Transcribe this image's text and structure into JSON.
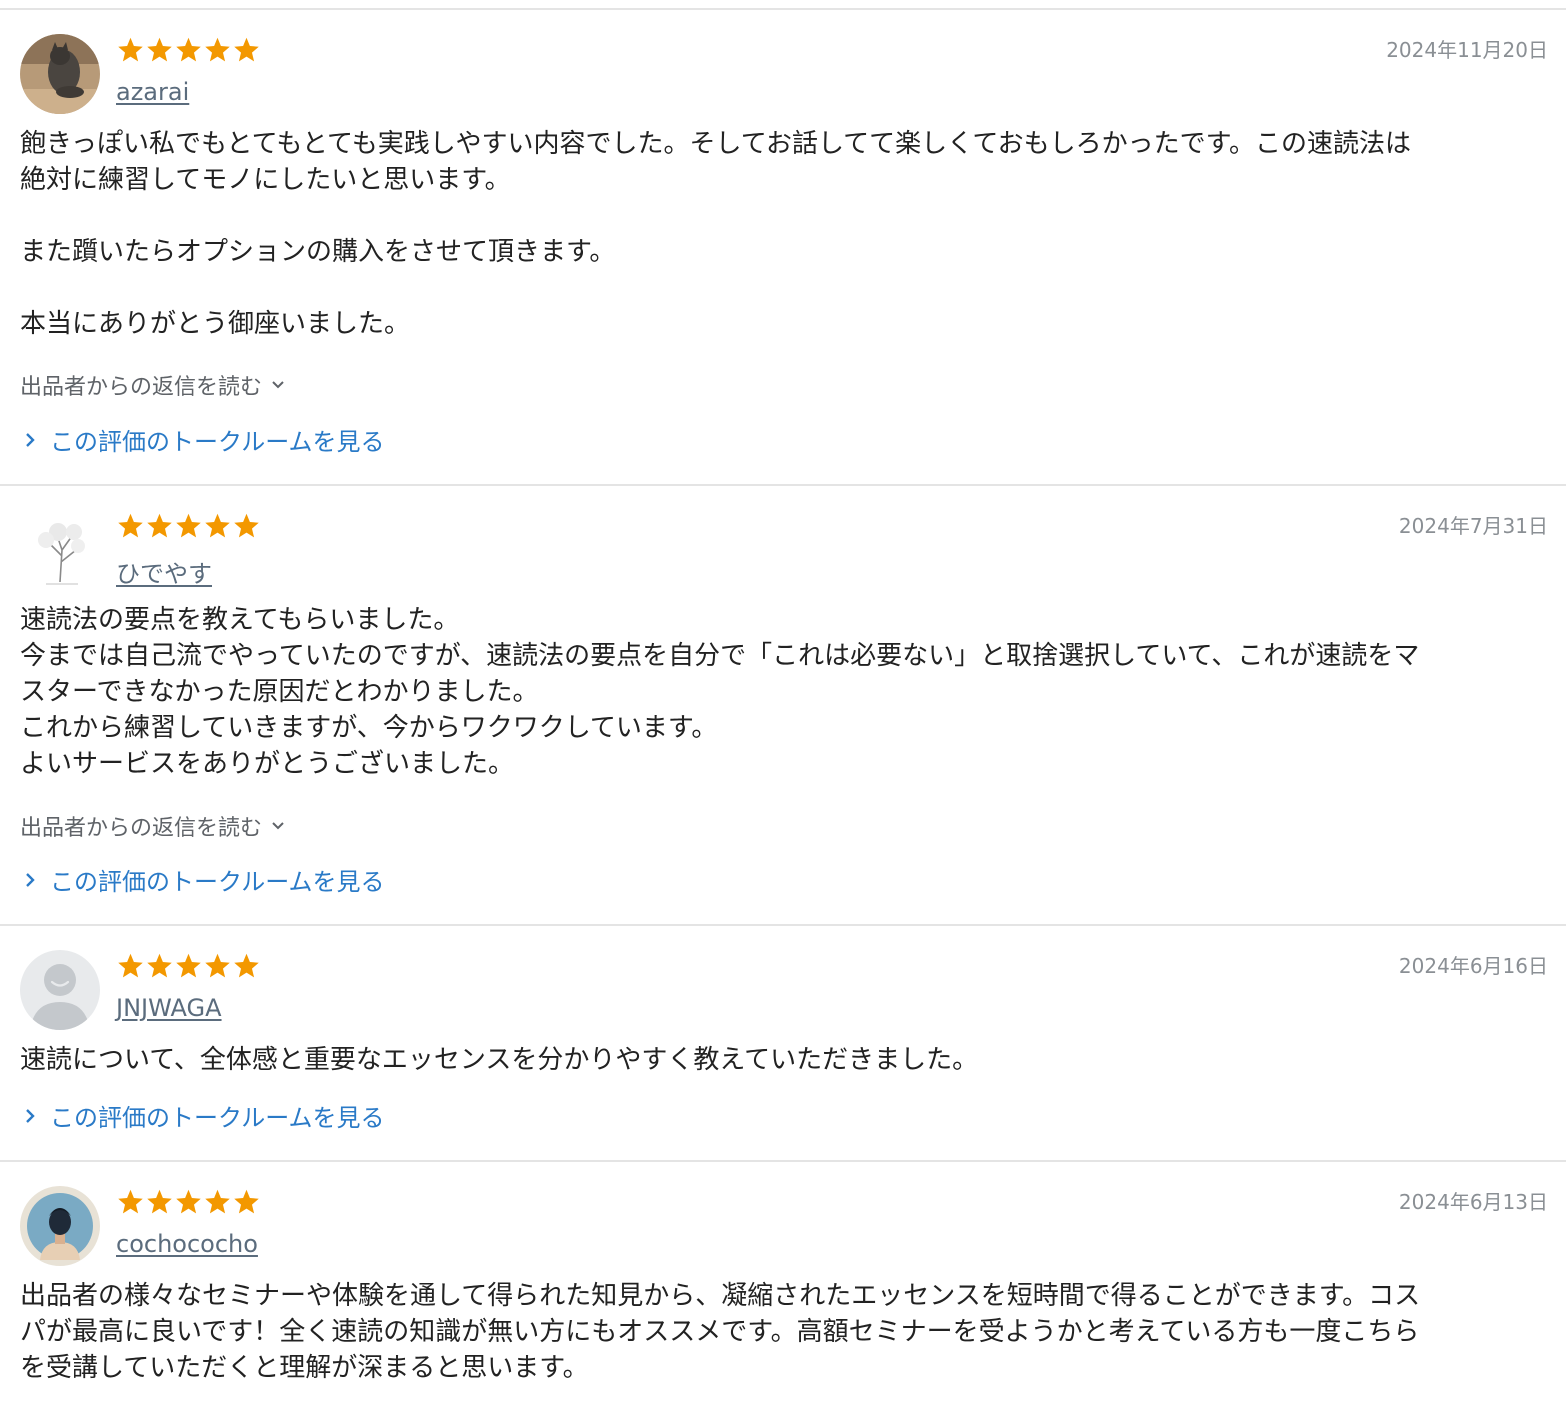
{
  "reviews": [
    {
      "avatar_icon": "cat-photo-avatar",
      "rating": 5,
      "username": "azarai",
      "date": "2024年11月20日",
      "paragraphs": [
        "飽きっぽい私でもとてもとても実践しやすい内容でした。そしてお話してて楽しくておもしろかったです。この速読法は\n絶対に練習してモノにしたいと思います。",
        "また躓いたらオプションの購入をさせて頂きます。",
        "本当にありがとう御座いました。"
      ],
      "reply_label": "出品者からの返信を読む",
      "talkroom_label": "この評価のトークルームを見る"
    },
    {
      "avatar_icon": "tree-sketch-avatar",
      "rating": 5,
      "username": "ひでやす",
      "date": "2024年7月31日",
      "paragraphs": [
        "速読法の要点を教えてもらいました。\n今までは自己流でやっていたのですが、速読法の要点を自分で「これは必要ない」と取捨選択していて、これが速読をマ\nスターできなかった原因だとわかりました。\nこれから練習していきますが、今からワクワクしています。\nよいサービスをありがとうございました。"
      ],
      "reply_label": "出品者からの返信を読む",
      "talkroom_label": "この評価のトークルームを見る"
    },
    {
      "avatar_icon": "default-user-avatar",
      "rating": 5,
      "username": "JNJWAGA",
      "date": "2024年6月16日",
      "paragraphs": [
        "速読について、全体感と重要なエッセンスを分かりやすく教えていただきました。"
      ],
      "reply_label": "",
      "talkroom_label": "この評価のトークルームを見る"
    },
    {
      "avatar_icon": "person-illustration-avatar",
      "rating": 5,
      "username": "cochococho",
      "date": "2024年6月13日",
      "paragraphs": [
        "出品者の様々なセミナーや体験を通して得られた知見から、凝縮されたエッセンスを短時間で得ることができます。コス\nパが最高に良いです！全く速読の知識が無い方にもオススメです。高額セミナーを受ようかと考えている方も一度こちら\nを受講していただくと理解が深まると思います。"
      ],
      "reply_label": "",
      "talkroom_label": ""
    }
  ],
  "colors": {
    "star": "#f39800",
    "link": "#2a7ac7",
    "username": "#5b6c7d",
    "date": "#8a8f94",
    "divider": "#e4e4e4"
  }
}
